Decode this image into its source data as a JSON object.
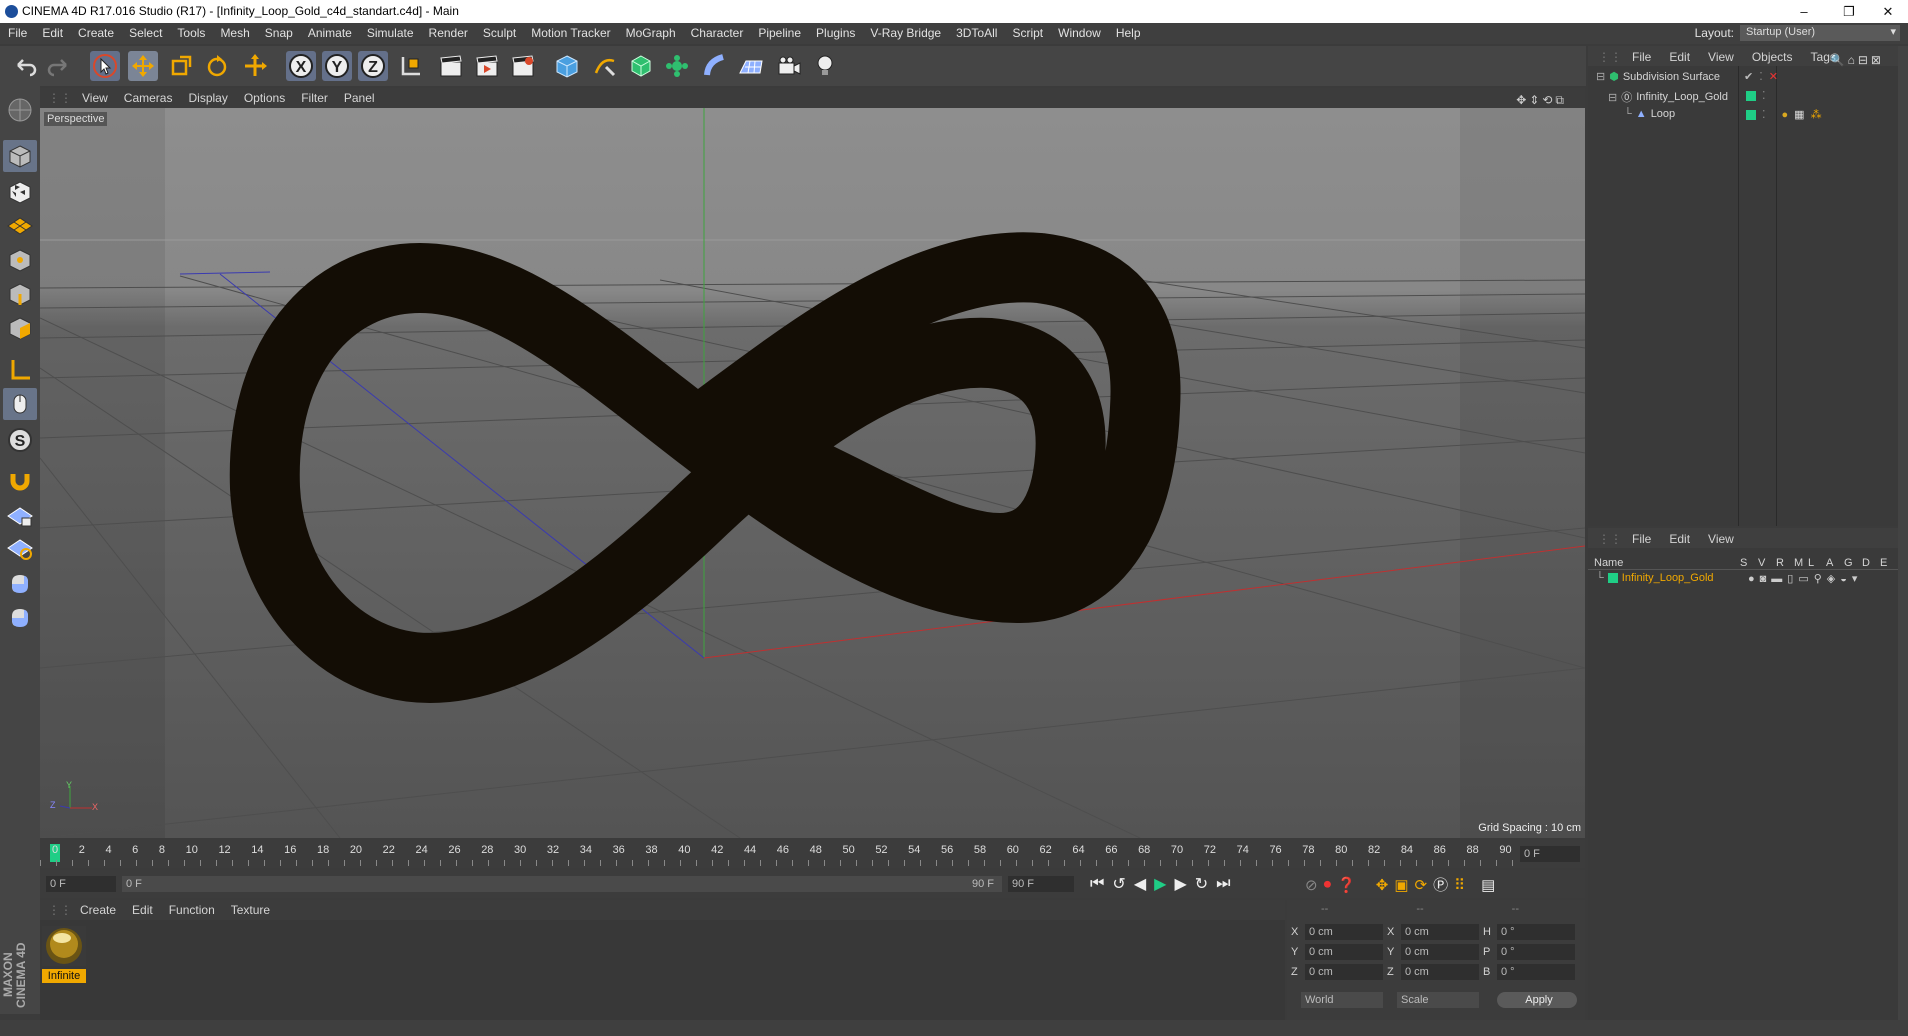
{
  "window": {
    "title": "CINEMA 4D R17.016 Studio (R17) - [Infinity_Loop_Gold_c4d_standart.c4d] - Main",
    "min": "–",
    "restore": "❐",
    "close": "✕"
  },
  "menu": [
    "File",
    "Edit",
    "Create",
    "Select",
    "Tools",
    "Mesh",
    "Snap",
    "Animate",
    "Simulate",
    "Render",
    "Sculpt",
    "Motion Tracker",
    "MoGraph",
    "Character",
    "Pipeline",
    "Plugins",
    "V-Ray Bridge",
    "3DToAll",
    "Script",
    "Window",
    "Help"
  ],
  "layout": {
    "label": "Layout:",
    "value": "Startup (User)"
  },
  "viewport": {
    "menu": [
      "View",
      "Cameras",
      "Display",
      "Options",
      "Filter",
      "Panel"
    ],
    "label": "Perspective",
    "grid_spacing": "Grid Spacing : 10 cm",
    "axis_y": "Y",
    "axis_z": "Z",
    "axis_x": "X"
  },
  "timeline": {
    "ticks": [
      "0",
      "2",
      "4",
      "6",
      "8",
      "10",
      "12",
      "14",
      "16",
      "18",
      "20",
      "22",
      "24",
      "26",
      "28",
      "30",
      "32",
      "34",
      "36",
      "38",
      "40",
      "42",
      "44",
      "46",
      "48",
      "50",
      "52",
      "54",
      "56",
      "58",
      "60",
      "62",
      "64",
      "66",
      "68",
      "70",
      "72",
      "74",
      "76",
      "78",
      "80",
      "82",
      "84",
      "86",
      "88",
      "90"
    ],
    "current": "0 F"
  },
  "frames": {
    "start": "0 F",
    "range_start": "0 F",
    "range_end": "90 F",
    "end": "90 F"
  },
  "material_menu": [
    "Create",
    "Edit",
    "Function",
    "Texture"
  ],
  "material": {
    "name": "Infinite"
  },
  "coords": {
    "headers": [
      "--",
      "--",
      "--"
    ],
    "rows": [
      {
        "a": "X",
        "av": "0 cm",
        "b": "X",
        "bv": "0 cm",
        "c": "H",
        "cv": "0 °"
      },
      {
        "a": "Y",
        "av": "0 cm",
        "b": "Y",
        "bv": "0 cm",
        "c": "P",
        "cv": "0 °"
      },
      {
        "a": "Z",
        "av": "0 cm",
        "b": "Z",
        "bv": "0 cm",
        "c": "B",
        "cv": "0 °"
      }
    ],
    "world": "World",
    "scale": "Scale",
    "apply": "Apply"
  },
  "objects_menu": [
    "File",
    "Edit",
    "View",
    "Objects",
    "Tags"
  ],
  "objects": [
    {
      "name": "Subdivision Surface"
    },
    {
      "name": "Infinity_Loop_Gold"
    },
    {
      "name": "Loop"
    }
  ],
  "layers_menu": [
    "File",
    "Edit",
    "View"
  ],
  "layers": {
    "headers": [
      "Name",
      "S",
      "V",
      "R",
      "M",
      "L",
      "A",
      "G",
      "D",
      "E"
    ],
    "item": "Infinity_Loop_Gold"
  },
  "brand": "MAXON CINEMA 4D",
  "colors": {
    "accent": "#64708a",
    "gold": "#f0a800",
    "green": "#1fce86"
  }
}
